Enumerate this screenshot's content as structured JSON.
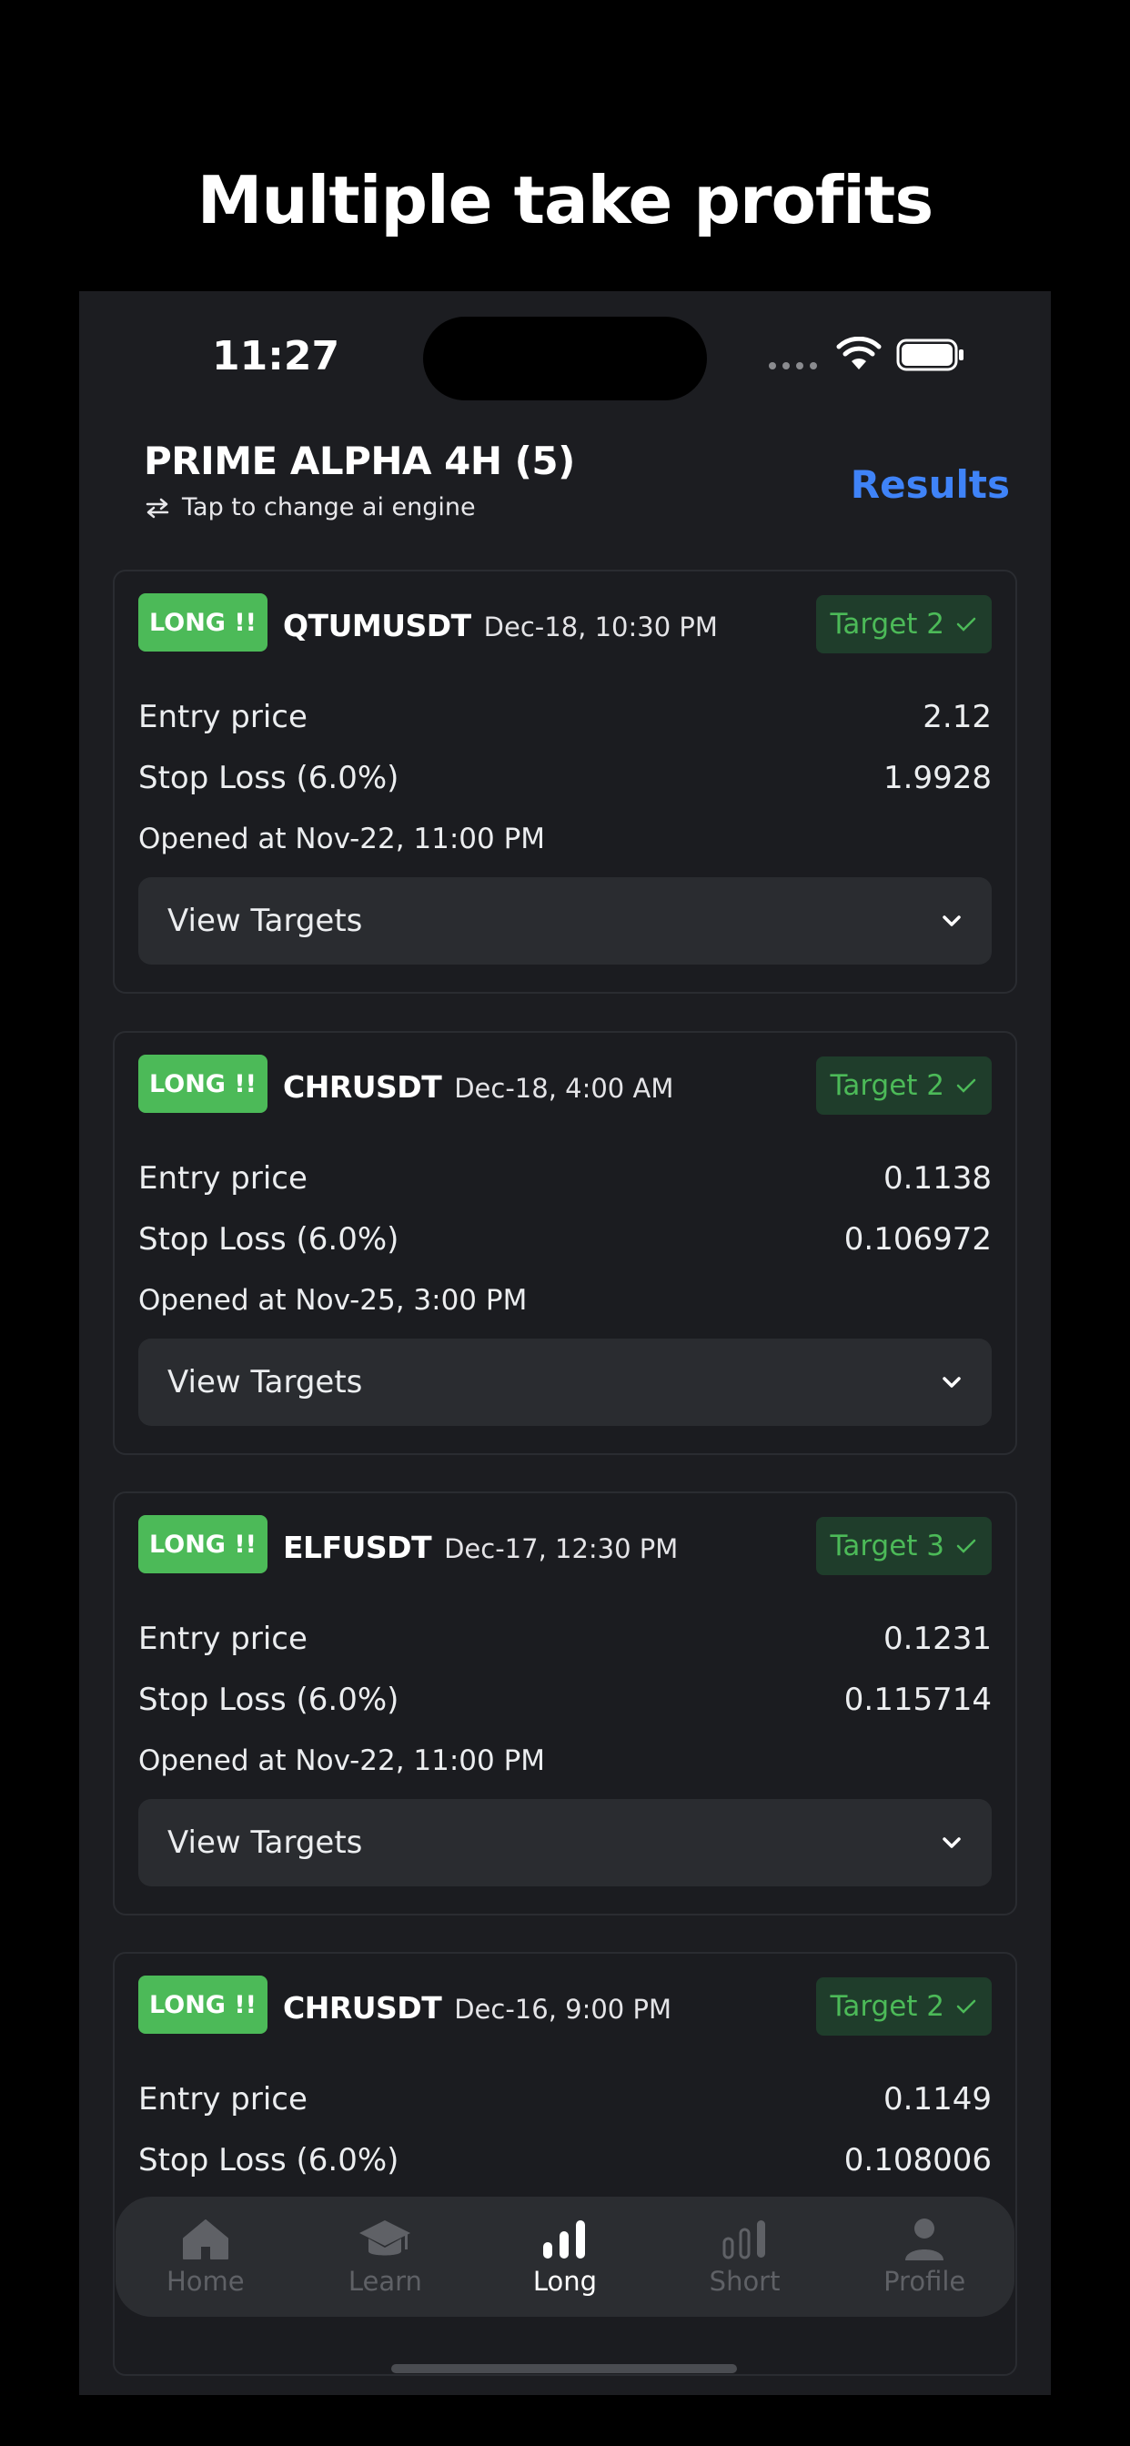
{
  "headline": "Multiple take profits",
  "status_bar": {
    "time": "11:27"
  },
  "header": {
    "engine_title": "PRIME ALPHA 4H (5)",
    "engine_subtitle": "Tap to change ai engine",
    "results_label": "Results"
  },
  "cards": [
    {
      "badge": "LONG !!",
      "pair": "QTUMUSDT",
      "date": "Dec-18, 10:30 PM",
      "target": "Target 2",
      "entry_label": "Entry price",
      "entry_value": "2.12",
      "stop_label": "Stop Loss (6.0%)",
      "stop_value": "1.9928",
      "opened": "Opened at Nov-22, 11:00 PM",
      "view_targets": "View Targets"
    },
    {
      "badge": "LONG !!",
      "pair": "CHRUSDT",
      "date": "Dec-18, 4:00 AM",
      "target": "Target 2",
      "entry_label": "Entry price",
      "entry_value": "0.1138",
      "stop_label": "Stop Loss (6.0%)",
      "stop_value": "0.106972",
      "opened": "Opened at Nov-25, 3:00 PM",
      "view_targets": "View Targets"
    },
    {
      "badge": "LONG !!",
      "pair": "ELFUSDT",
      "date": "Dec-17, 12:30 PM",
      "target": "Target 3",
      "entry_label": "Entry price",
      "entry_value": "0.1231",
      "stop_label": "Stop Loss (6.0%)",
      "stop_value": "0.115714",
      "opened": "Opened at Nov-22, 11:00 PM",
      "view_targets": "View Targets"
    },
    {
      "badge": "LONG !!",
      "pair": "CHRUSDT",
      "date": "Dec-16, 9:00 PM",
      "target": "Target 2",
      "entry_label": "Entry price",
      "entry_value": "0.1149",
      "stop_label": "Stop Loss (6.0%)",
      "stop_value": "0.108006"
    }
  ],
  "tabs": [
    {
      "label": "Home",
      "icon": "home-icon",
      "active": false
    },
    {
      "label": "Learn",
      "icon": "graduation-cap-icon",
      "active": false
    },
    {
      "label": "Long",
      "icon": "bars-up-icon",
      "active": true
    },
    {
      "label": "Short",
      "icon": "bars-down-icon",
      "active": false
    },
    {
      "label": "Profile",
      "icon": "person-icon",
      "active": false
    }
  ],
  "colors": {
    "accent_blue": "#3f83f8",
    "long_green": "#4cba58",
    "target_bg": "#1f3d2b",
    "card_bg": "#1b1c20",
    "screen_bg": "#1c1d21"
  }
}
